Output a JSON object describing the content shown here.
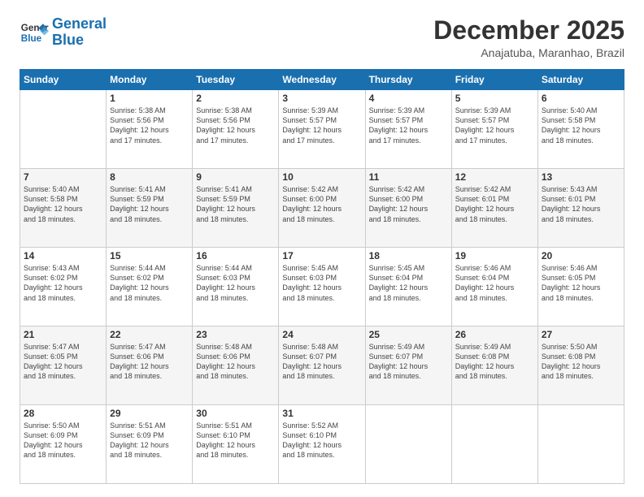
{
  "logo": {
    "line1": "General",
    "line2": "Blue"
  },
  "title": "December 2025",
  "subtitle": "Anajatuba, Maranhao, Brazil",
  "days_of_week": [
    "Sunday",
    "Monday",
    "Tuesday",
    "Wednesday",
    "Thursday",
    "Friday",
    "Saturday"
  ],
  "weeks": [
    [
      {
        "date": "",
        "sunrise": "",
        "sunset": "",
        "daylight": ""
      },
      {
        "date": "1",
        "sunrise": "Sunrise: 5:38 AM",
        "sunset": "Sunset: 5:56 PM",
        "daylight": "Daylight: 12 hours and 17 minutes."
      },
      {
        "date": "2",
        "sunrise": "Sunrise: 5:38 AM",
        "sunset": "Sunset: 5:56 PM",
        "daylight": "Daylight: 12 hours and 17 minutes."
      },
      {
        "date": "3",
        "sunrise": "Sunrise: 5:39 AM",
        "sunset": "Sunset: 5:57 PM",
        "daylight": "Daylight: 12 hours and 17 minutes."
      },
      {
        "date": "4",
        "sunrise": "Sunrise: 5:39 AM",
        "sunset": "Sunset: 5:57 PM",
        "daylight": "Daylight: 12 hours and 17 minutes."
      },
      {
        "date": "5",
        "sunrise": "Sunrise: 5:39 AM",
        "sunset": "Sunset: 5:57 PM",
        "daylight": "Daylight: 12 hours and 17 minutes."
      },
      {
        "date": "6",
        "sunrise": "Sunrise: 5:40 AM",
        "sunset": "Sunset: 5:58 PM",
        "daylight": "Daylight: 12 hours and 18 minutes."
      }
    ],
    [
      {
        "date": "7",
        "sunrise": "Sunrise: 5:40 AM",
        "sunset": "Sunset: 5:58 PM",
        "daylight": "Daylight: 12 hours and 18 minutes."
      },
      {
        "date": "8",
        "sunrise": "Sunrise: 5:41 AM",
        "sunset": "Sunset: 5:59 PM",
        "daylight": "Daylight: 12 hours and 18 minutes."
      },
      {
        "date": "9",
        "sunrise": "Sunrise: 5:41 AM",
        "sunset": "Sunset: 5:59 PM",
        "daylight": "Daylight: 12 hours and 18 minutes."
      },
      {
        "date": "10",
        "sunrise": "Sunrise: 5:42 AM",
        "sunset": "Sunset: 6:00 PM",
        "daylight": "Daylight: 12 hours and 18 minutes."
      },
      {
        "date": "11",
        "sunrise": "Sunrise: 5:42 AM",
        "sunset": "Sunset: 6:00 PM",
        "daylight": "Daylight: 12 hours and 18 minutes."
      },
      {
        "date": "12",
        "sunrise": "Sunrise: 5:42 AM",
        "sunset": "Sunset: 6:01 PM",
        "daylight": "Daylight: 12 hours and 18 minutes."
      },
      {
        "date": "13",
        "sunrise": "Sunrise: 5:43 AM",
        "sunset": "Sunset: 6:01 PM",
        "daylight": "Daylight: 12 hours and 18 minutes."
      }
    ],
    [
      {
        "date": "14",
        "sunrise": "Sunrise: 5:43 AM",
        "sunset": "Sunset: 6:02 PM",
        "daylight": "Daylight: 12 hours and 18 minutes."
      },
      {
        "date": "15",
        "sunrise": "Sunrise: 5:44 AM",
        "sunset": "Sunset: 6:02 PM",
        "daylight": "Daylight: 12 hours and 18 minutes."
      },
      {
        "date": "16",
        "sunrise": "Sunrise: 5:44 AM",
        "sunset": "Sunset: 6:03 PM",
        "daylight": "Daylight: 12 hours and 18 minutes."
      },
      {
        "date": "17",
        "sunrise": "Sunrise: 5:45 AM",
        "sunset": "Sunset: 6:03 PM",
        "daylight": "Daylight: 12 hours and 18 minutes."
      },
      {
        "date": "18",
        "sunrise": "Sunrise: 5:45 AM",
        "sunset": "Sunset: 6:04 PM",
        "daylight": "Daylight: 12 hours and 18 minutes."
      },
      {
        "date": "19",
        "sunrise": "Sunrise: 5:46 AM",
        "sunset": "Sunset: 6:04 PM",
        "daylight": "Daylight: 12 hours and 18 minutes."
      },
      {
        "date": "20",
        "sunrise": "Sunrise: 5:46 AM",
        "sunset": "Sunset: 6:05 PM",
        "daylight": "Daylight: 12 hours and 18 minutes."
      }
    ],
    [
      {
        "date": "21",
        "sunrise": "Sunrise: 5:47 AM",
        "sunset": "Sunset: 6:05 PM",
        "daylight": "Daylight: 12 hours and 18 minutes."
      },
      {
        "date": "22",
        "sunrise": "Sunrise: 5:47 AM",
        "sunset": "Sunset: 6:06 PM",
        "daylight": "Daylight: 12 hours and 18 minutes."
      },
      {
        "date": "23",
        "sunrise": "Sunrise: 5:48 AM",
        "sunset": "Sunset: 6:06 PM",
        "daylight": "Daylight: 12 hours and 18 minutes."
      },
      {
        "date": "24",
        "sunrise": "Sunrise: 5:48 AM",
        "sunset": "Sunset: 6:07 PM",
        "daylight": "Daylight: 12 hours and 18 minutes."
      },
      {
        "date": "25",
        "sunrise": "Sunrise: 5:49 AM",
        "sunset": "Sunset: 6:07 PM",
        "daylight": "Daylight: 12 hours and 18 minutes."
      },
      {
        "date": "26",
        "sunrise": "Sunrise: 5:49 AM",
        "sunset": "Sunset: 6:08 PM",
        "daylight": "Daylight: 12 hours and 18 minutes."
      },
      {
        "date": "27",
        "sunrise": "Sunrise: 5:50 AM",
        "sunset": "Sunset: 6:08 PM",
        "daylight": "Daylight: 12 hours and 18 minutes."
      }
    ],
    [
      {
        "date": "28",
        "sunrise": "Sunrise: 5:50 AM",
        "sunset": "Sunset: 6:09 PM",
        "daylight": "Daylight: 12 hours and 18 minutes."
      },
      {
        "date": "29",
        "sunrise": "Sunrise: 5:51 AM",
        "sunset": "Sunset: 6:09 PM",
        "daylight": "Daylight: 12 hours and 18 minutes."
      },
      {
        "date": "30",
        "sunrise": "Sunrise: 5:51 AM",
        "sunset": "Sunset: 6:10 PM",
        "daylight": "Daylight: 12 hours and 18 minutes."
      },
      {
        "date": "31",
        "sunrise": "Sunrise: 5:52 AM",
        "sunset": "Sunset: 6:10 PM",
        "daylight": "Daylight: 12 hours and 18 minutes."
      },
      {
        "date": "",
        "sunrise": "",
        "sunset": "",
        "daylight": ""
      },
      {
        "date": "",
        "sunrise": "",
        "sunset": "",
        "daylight": ""
      },
      {
        "date": "",
        "sunrise": "",
        "sunset": "",
        "daylight": ""
      }
    ]
  ]
}
